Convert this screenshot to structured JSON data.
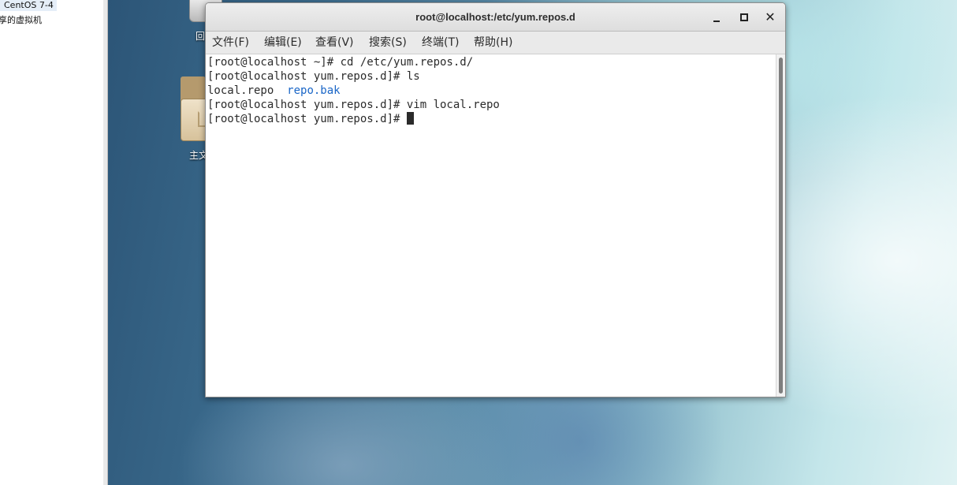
{
  "library": {
    "selected_vm": "CentOS 7-4",
    "shared_vms": "享的虚拟机"
  },
  "desktop": {
    "trash_label": "回",
    "home_label": "主文"
  },
  "window": {
    "title": "root@localhost:/etc/yum.repos.d",
    "minimize_label": "",
    "maximize_label": "",
    "close_label": "✕"
  },
  "menu": {
    "file": "文件(F)",
    "edit": "编辑(E)",
    "view": "查看(V)",
    "search": "搜索(S)",
    "terminal": "终端(T)",
    "help": "帮助(H)"
  },
  "terminal": {
    "line1": "[root@localhost ~]# cd /etc/yum.repos.d/",
    "line2": "[root@localhost yum.repos.d]# ls",
    "line3_file1": "local.repo  ",
    "line3_dir": "repo.bak",
    "line4": "[root@localhost yum.repos.d]# vim local.repo",
    "line5": "[root@localhost yum.repos.d]# "
  },
  "colors": {
    "directory": "#1a66c7",
    "terminal_text": "#2b2b2b",
    "titlebar": "#e6e6e6"
  }
}
